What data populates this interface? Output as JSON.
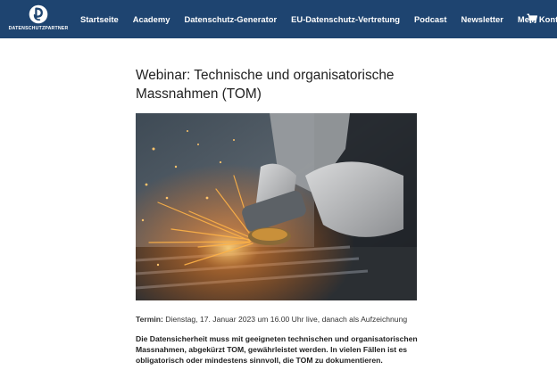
{
  "brand": {
    "name": "DATENSCHUTZPARTNER",
    "logo_icon": "dp-circle-logo-icon",
    "color": "#1e4470"
  },
  "nav": {
    "items": [
      {
        "label": "Startseite"
      },
      {
        "label": "Academy"
      },
      {
        "label": "Datenschutz-Generator"
      },
      {
        "label": "EU-Datenschutz-Vertretung"
      },
      {
        "label": "Podcast"
      },
      {
        "label": "Newsletter"
      },
      {
        "label": "Mein Konto"
      }
    ],
    "cart_icon": "cart-icon"
  },
  "article": {
    "title": "Webinar: Technische und organisatorische Massnahmen (TOM)",
    "image_subject": "angle-grinder-sparks-photo",
    "termin_label": "Termin:",
    "termin_value": " Dienstag, 17. Januar 2023 um 16.00 Uhr live, danach als Aufzeichnung",
    "intro": "Die Datensicherheit muss mit geeigneten technischen und organisatorischen Massnahmen, abgekürzt TOM, gewährleistet werden. In vielen Fällen ist es obligatorisch oder mindestens sinnvoll, die TOM zu dokumentieren."
  }
}
